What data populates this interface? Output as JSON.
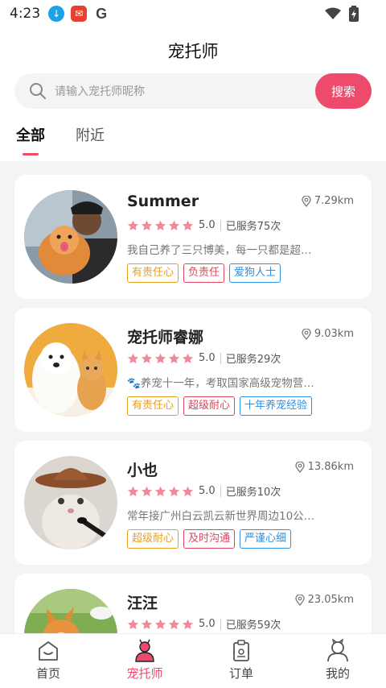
{
  "status": {
    "time": "4:23"
  },
  "page": {
    "title": "宠托师"
  },
  "search": {
    "placeholder": "请输入宠托师昵称",
    "button": "搜索"
  },
  "tabs": [
    {
      "label": "全部"
    },
    {
      "label": "附近"
    }
  ],
  "sitters": [
    {
      "name": "Summer",
      "distance": "7.29km",
      "rating": "5.0",
      "served": "已服务75次",
      "desc": "我自己养了三只博美，每一只都是超…",
      "tags": [
        "有责任心",
        "负责任",
        "爱狗人士"
      ]
    },
    {
      "name": "宠托师睿娜",
      "distance": "9.03km",
      "rating": "5.0",
      "served": "已服务29次",
      "desc": "🐾养宠十一年，考取国家高级宠物营…",
      "tags": [
        "有责任心",
        "超级耐心",
        "十年养宠经验"
      ]
    },
    {
      "name": "小也",
      "distance": "13.86km",
      "rating": "5.0",
      "served": "已服务10次",
      "desc": "常年接广州白云凯云新世界周边10公…",
      "tags": [
        "超级耐心",
        "及时沟通",
        "严谨心细"
      ]
    },
    {
      "name": "汪汪",
      "distance": "23.05km",
      "rating": "5.0",
      "served": "已服务59次",
      "desc": "",
      "tags": []
    }
  ],
  "nav": [
    {
      "label": "首页"
    },
    {
      "label": "宠托师"
    },
    {
      "label": "订单"
    },
    {
      "label": "我的"
    }
  ],
  "colors": {
    "accent": "#ee4b6c",
    "star": "#f08a9a",
    "tag_orange": "#e8a020",
    "tag_red": "#e0465f",
    "tag_blue": "#2f8fe0"
  }
}
